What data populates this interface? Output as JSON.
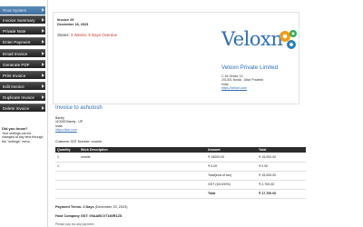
{
  "sidebar": {
    "items": [
      {
        "label": "Root System"
      },
      {
        "label": "Invoice Summary"
      },
      {
        "label": "Private Note"
      },
      {
        "label": "Enter Payment"
      },
      {
        "label": "Email Invoice"
      },
      {
        "label": "Generate PDF"
      },
      {
        "label": "Print Invoice"
      },
      {
        "label": "Edit Invoice"
      },
      {
        "label": "Duplicate Invoice"
      },
      {
        "label": "Delete Invoice"
      }
    ],
    "did_you_know": {
      "title": "Did you know?",
      "text": "Your settings can be changed at any time through the \"settings\" menu."
    }
  },
  "invoice": {
    "number": "Invoice 29",
    "date": "December 18, 2023",
    "status_label": "Status:",
    "status_value": "3 Weeks, 5 Days Overdue"
  },
  "company": {
    "logo_text": "Veloxn",
    "name": "Veloxn Private Limited",
    "address_lines": [
      "C-54 Sector 10",
      "201301 Noida , Uttar Pradesh",
      "India"
    ],
    "website": "https://veloxn.com"
  },
  "client": {
    "heading": "Invoice to ashutosh",
    "lines": [
      "Barely",
      "110033 Barely , UP",
      "India"
    ],
    "website": "https://abc.com",
    "gst": "Customer GST Number: vuvuhb"
  },
  "table": {
    "headers": [
      "Quantity",
      "Work Description",
      "Amount",
      "Total"
    ],
    "rows": [
      {
        "qty": "1",
        "desc": "mobile",
        "amount": "₹ 15000.00",
        "total": "₹ 15,000.00"
      },
      {
        "qty": "1",
        "desc": "",
        "amount": "₹ 0.00",
        "total": "₹ 0.00"
      }
    ],
    "summary": [
      {
        "label": "Total(excl.of tax)",
        "value": "₹ 15,000.00"
      },
      {
        "label": "GST (18.000%)",
        "value": "₹ 2,700.00"
      },
      {
        "label": "Total",
        "value": "₹ 17,700.00"
      }
    ]
  },
  "footer": {
    "payment_terms_label": "Payment Terms:",
    "payment_terms_value": "2 Days",
    "payment_terms_date": "(December 20, 2023)",
    "host_gst": "Host Company GST: 09AABCV7180R1ZS",
    "note": "Please pay via any payment"
  },
  "colors": {
    "accent": "#2e6fb5",
    "overdue": "#c0392b",
    "sidebar_bg": "#2b2b2b",
    "gear_orange": "#f39c12",
    "gear_green": "#27ae60",
    "gear_blue": "#2980b9"
  },
  "icons": [
    "arrow-right-icon",
    "gear-icon"
  ]
}
